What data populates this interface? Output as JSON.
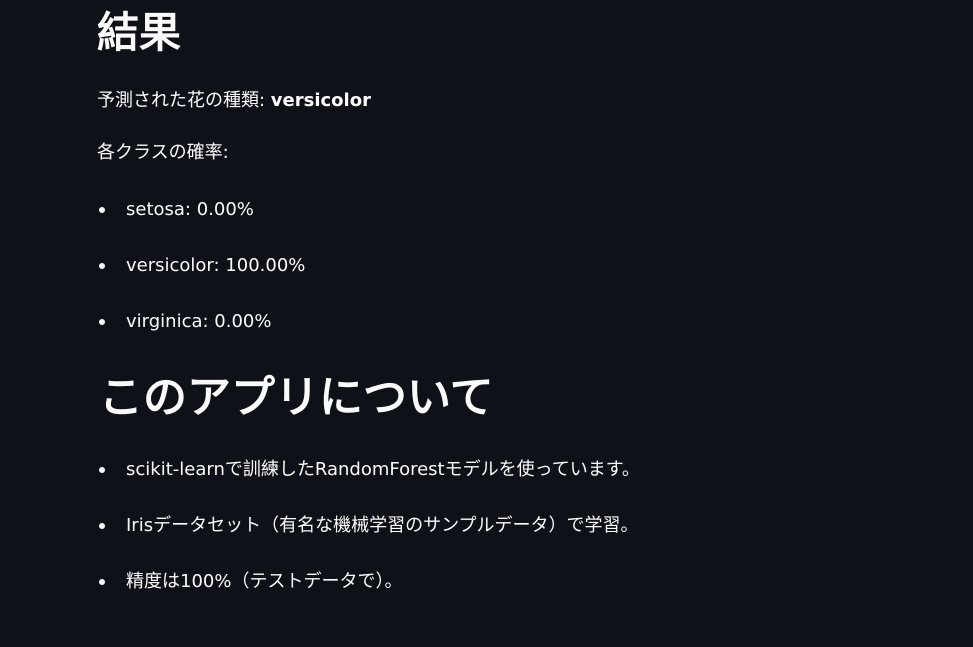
{
  "result": {
    "heading": "結果",
    "prediction_label": "予測された花の種類: ",
    "prediction_value": "versicolor",
    "prob_heading": "各クラスの確率:",
    "probs": [
      "setosa: 0.00%",
      "versicolor: 100.00%",
      "virginica: 0.00%"
    ]
  },
  "about": {
    "heading": "このアプリについて",
    "items": [
      "scikit-learnで訓練したRandomForestモデルを使っています。",
      "Irisデータセット（有名な機械学習のサンプルデータ）で学習。",
      "精度は100%（テストデータで）。"
    ]
  }
}
